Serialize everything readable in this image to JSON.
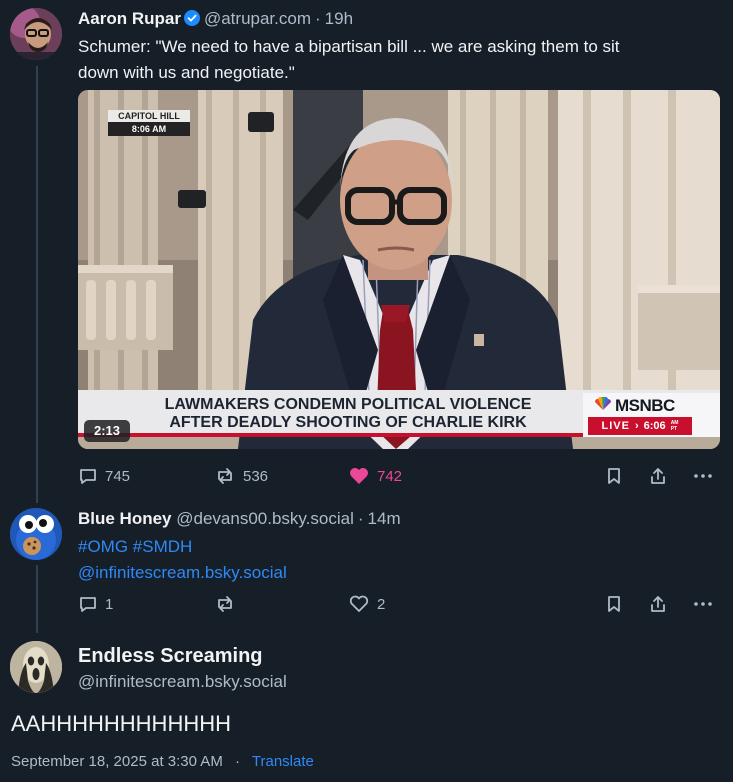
{
  "post1": {
    "display_name": "Aaron Rupar",
    "handle": "@atrupar.com",
    "separator": "·",
    "time": "19h",
    "text_line1": "Schumer: \"We need to have a bipartisan bill ... we are asking them to sit",
    "text_line2": "down with us and negotiate.\"",
    "video": {
      "location_tag": "CAPITOL HILL",
      "location_time": "8:06 AM",
      "chyron_line1": "LAWMAKERS CONDEMN POLITICAL VIOLENCE",
      "chyron_line2": "AFTER DEADLY SHOOTING OF CHARLIE KIRK",
      "network": "MSNBC",
      "live_label": "LIVE",
      "live_arrow": "›",
      "live_time": "6:06",
      "live_time_suffix_top": "AM",
      "live_time_suffix_bottom": "PT",
      "duration": "2:13"
    },
    "replies": "745",
    "reposts": "536",
    "likes": "742",
    "liked_color": "#ec4899"
  },
  "post2": {
    "display_name": "Blue Honey",
    "handle": "@devans00.bsky.social",
    "separator": "·",
    "time": "14m",
    "hashtags": "#OMG #SMDH",
    "mention": "@infinitescream.bsky.social",
    "replies": "1",
    "reposts": "",
    "likes": "2"
  },
  "post3": {
    "display_name": "Endless Screaming",
    "handle": "@infinitescream.bsky.social",
    "text": "AAHHHHHHHHHHHH",
    "timestamp": "September 18, 2025 at 3:30 AM",
    "separator": "·",
    "translate_label": "Translate"
  },
  "colors": {
    "background": "#161e27",
    "text_primary": "#f1f3f5",
    "text_secondary": "#aebbc9",
    "link": "#2f89f5",
    "verified_badge": "#1a8cff",
    "thread_line": "#2e4052"
  },
  "icons": [
    "verified-badge-icon",
    "reply-icon",
    "repost-icon",
    "like-icon",
    "bookmark-icon",
    "share-icon",
    "more-icon"
  ]
}
